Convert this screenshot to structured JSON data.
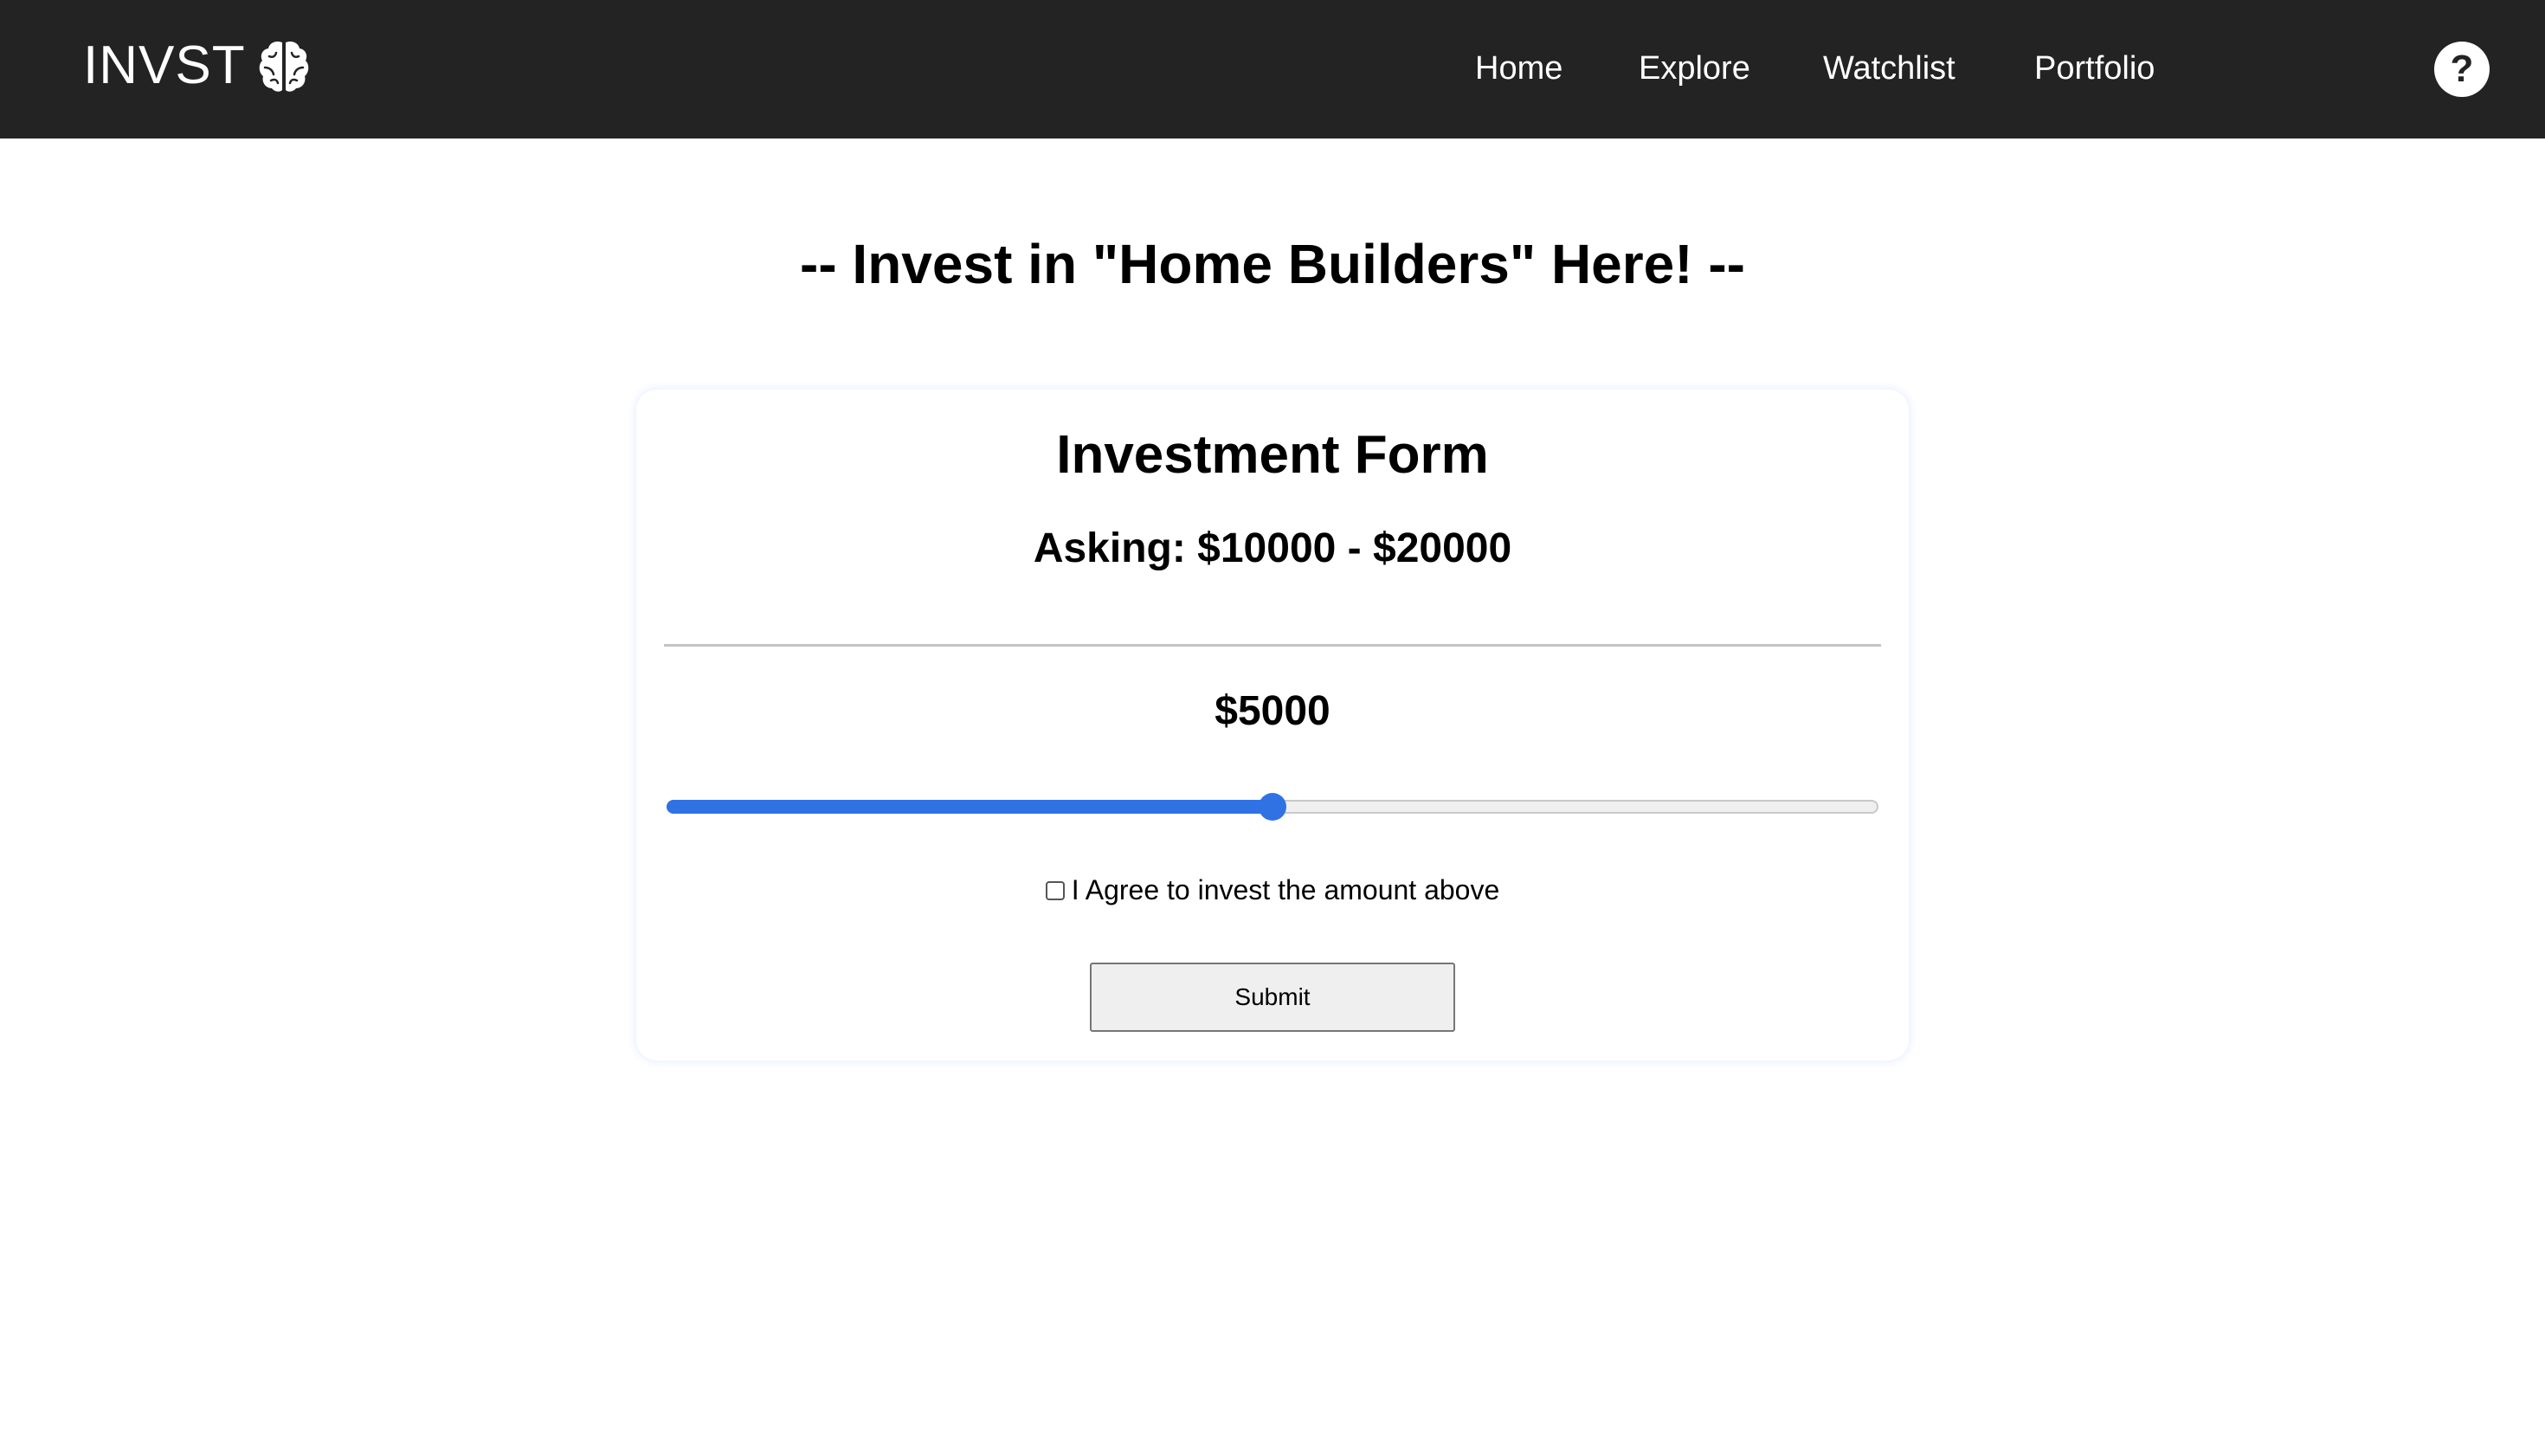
{
  "navbar": {
    "logo_text": "INVST",
    "logo_icon": "brain-icon",
    "links": [
      "Home",
      "Explore",
      "Watchlist",
      "Portfolio"
    ],
    "help_label": "?",
    "background": "#232323"
  },
  "page": {
    "heading": "-- Invest in \"Home Builders\" Here! --"
  },
  "form": {
    "title": "Investment Form",
    "asking": "Asking: $10000 - $20000",
    "amount": "$5000",
    "slider_fraction": 0.5,
    "accent": "#3072e4",
    "agree_label": "I Agree to invest the amount above",
    "agree_checked": false,
    "submit_label": "Submit"
  }
}
